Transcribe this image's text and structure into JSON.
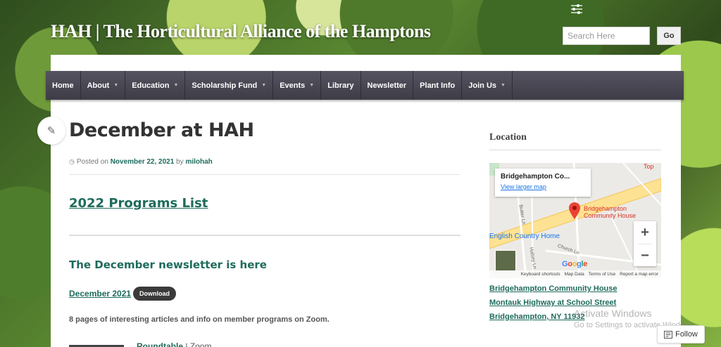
{
  "site": {
    "title": "HAH | The Horticultural Alliance of the Hamptons"
  },
  "search": {
    "placeholder": "Search Here",
    "button": "Go"
  },
  "nav": {
    "items": [
      {
        "label": "Home",
        "dropdown": false
      },
      {
        "label": "About",
        "dropdown": true
      },
      {
        "label": "Education",
        "dropdown": true
      },
      {
        "label": "Scholarship Fund",
        "dropdown": true
      },
      {
        "label": "Events",
        "dropdown": true
      },
      {
        "label": "Library",
        "dropdown": false
      },
      {
        "label": "Newsletter",
        "dropdown": false
      },
      {
        "label": "Plant Info",
        "dropdown": false
      },
      {
        "label": "Join Us",
        "dropdown": true
      }
    ]
  },
  "post": {
    "title": "December at HAH",
    "meta_prefix": "Posted on",
    "date": "November 22, 2021",
    "by": "by",
    "author": "milohah",
    "programs_link": "2022 Programs List",
    "newsletter_heading": "The December newsletter is here",
    "issue_link": "December 2021",
    "download_label": "Download",
    "newsletter_desc": "8 pages of interesting articles and info on member programs on Zoom.",
    "roundtable_link": "Roundtable",
    "roundtable_suffix": " | Zoom"
  },
  "sidebar": {
    "location_title": "Location",
    "map": {
      "card_place": "Bridgehampton Co...",
      "card_link": "View larger map",
      "pin_label": "Bridgehampton Community House",
      "pin_label_line1": "Bridgehampton",
      "pin_label_line2": "Community House",
      "top_label": "Top",
      "english_label": "English Country Home",
      "street_butter": "Butter Ln",
      "street_church": "Church Ln",
      "street_halsey": "Halsey Ln",
      "footer": [
        "Keyboard shortcuts",
        "Map Data",
        "Terms of Use",
        "Report a map error"
      ],
      "zoom_in": "+",
      "zoom_out": "−",
      "logo": "Google"
    },
    "address": [
      "Bridgehampton Community House",
      "Montauk Highway at School Street",
      "Bridgehampton, NY 11932"
    ]
  },
  "os_watermark": {
    "line1": "Activate Windows",
    "line2": "Go to Settings to activate Windows."
  },
  "follow": {
    "label": "Follow"
  }
}
